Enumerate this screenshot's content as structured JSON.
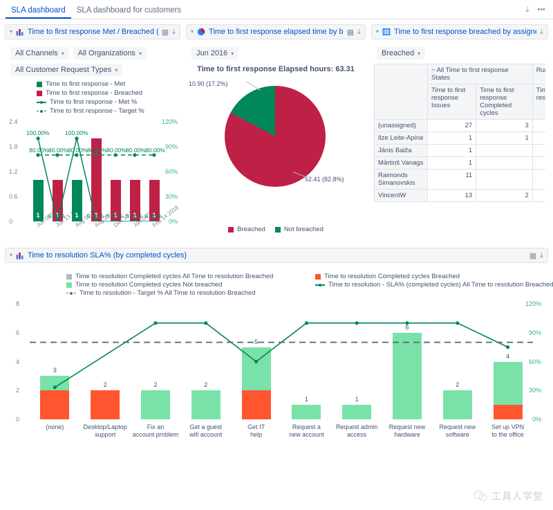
{
  "tabs": [
    {
      "label": "SLA dashboard",
      "active": true
    },
    {
      "label": "SLA dashboard for customers",
      "active": false
    }
  ],
  "header_actions": {
    "download": "⤓",
    "more": "•••"
  },
  "gadgets": {
    "first_response_met_breached": {
      "title": "Time to first response Met / Breached (by days",
      "icon": "bar-chart-icon",
      "actions": {
        "table": "▦",
        "download": "⤓"
      },
      "filters": [
        "All Channels",
        "All Organizations",
        "All Customer Request Types"
      ],
      "legend": [
        {
          "label": "Time to first response - Met",
          "color": "#00875A",
          "kind": "square"
        },
        {
          "label": "Time to first response - Breached",
          "color": "#BF2045",
          "kind": "square"
        },
        {
          "label": "Time to first response - Met %",
          "color": "#00875A",
          "kind": "line"
        },
        {
          "label": "Time to first response - Target %",
          "color": "#00875A",
          "kind": "dashed"
        }
      ]
    },
    "first_response_elapsed": {
      "title": "Time to first response elapsed time by breache",
      "icon": "pie-chart-icon",
      "actions": {
        "table": "▦",
        "download": "⤓"
      },
      "filters": [
        "Jun 2016"
      ],
      "subtitle": "Time to first response Elapsed hours: 63.31"
    },
    "breached_by_assignees": {
      "title": "Time to first response breached by assignees",
      "icon": "table-icon",
      "actions": {
        "download": "⤓"
      },
      "filters": [
        "Breached"
      ],
      "group_headers": [
        "All Time to first response States",
        "Runnin"
      ],
      "column_headers": [
        "Time to first response Issues",
        "Time to first response Completed cycles",
        "Time to first respon Issues"
      ],
      "rows": [
        {
          "name": "(unassigned)",
          "issues": "27",
          "completed": "3",
          "running": ""
        },
        {
          "name": "Ilze Leite-Apine",
          "issues": "1",
          "completed": "1",
          "running": ""
        },
        {
          "name": "Jānis Baiža",
          "issues": "1",
          "completed": "",
          "running": ""
        },
        {
          "name": "Mārtiņš Vanags",
          "issues": "1",
          "completed": "",
          "running": ""
        },
        {
          "name": "Raimonds Simanovskis",
          "issues": "11",
          "completed": "",
          "running": ""
        },
        {
          "name": "VincentW",
          "issues": "13",
          "completed": "2",
          "running": ""
        }
      ]
    },
    "resolution_sla": {
      "title": "Time to resolution SLA% (by completed cycles)",
      "icon": "bar-chart-icon",
      "actions": {
        "table": "▦",
        "download": "⤓"
      },
      "legend": [
        {
          "label": "Time to resolution Completed cycles All Time to resolution Breached",
          "color": "#B3BAC5",
          "kind": "square"
        },
        {
          "label": "Time to resolution Completed cycles Not breached",
          "color": "#79E2A8",
          "kind": "square"
        },
        {
          "label": "Time to resolution - Target % All Time to resolution Breached",
          "color": "#5E6C84",
          "kind": "dashed"
        },
        {
          "label": "Time to resolution Completed cycles Breached",
          "color": "#FF5630",
          "kind": "square"
        },
        {
          "label": "Time to resolution - SLA% (completed cycles) All Time to resolution Breached",
          "color": "#00875A",
          "kind": "line"
        }
      ]
    }
  },
  "chart_data": [
    {
      "type": "bar",
      "id": "first-response-met-breached",
      "title": "Time to first response Met / Breached (by days)",
      "categories": [
        "Jun 05 2016",
        "Jun 13 2016",
        "Aug 01 2016",
        "Aug 25 2017",
        "Dec 18 2017",
        "Jan 04 2018",
        "Feb 14 2018"
      ],
      "series": [
        {
          "name": "Time to first response - Met",
          "color": "#00875A",
          "values": [
            1,
            0,
            1,
            0,
            0,
            0,
            0
          ]
        },
        {
          "name": "Time to first response - Breached",
          "color": "#BF2045",
          "values": [
            0,
            1,
            0,
            2,
            1,
            1,
            1
          ]
        },
        {
          "name": "Time to first response - Met %",
          "color": "#00875A",
          "axis": "right",
          "values": [
            100.0,
            0.0,
            100.0,
            0.0,
            0.0,
            0.0,
            0.0
          ],
          "labels": [
            "100.00%",
            "0.00%",
            "100.00%",
            "0.00%",
            "0.00%",
            "0.00%",
            "0.00%"
          ]
        },
        {
          "name": "Time to first response - Target %",
          "color": "#00875A",
          "axis": "right",
          "dashed": true,
          "values": [
            80.0,
            80.0,
            80.0,
            80.0,
            80.0,
            80.0,
            80.0
          ],
          "labels": [
            "80.00%",
            "80.00%",
            "80.00%",
            "80.00%",
            "80.00%",
            "80.00%",
            "80.00%"
          ]
        }
      ],
      "ylabel": "",
      "ylim": [
        0,
        2.4
      ],
      "yticks": [
        "0",
        "0.6",
        "1.2",
        "1.8",
        "2.4"
      ],
      "y2lim": [
        0,
        120
      ],
      "y2ticks": [
        "0%",
        "30%",
        "60%",
        "90%",
        "120%"
      ],
      "grid": false,
      "legend_position": "top"
    },
    {
      "type": "pie",
      "id": "first-response-elapsed",
      "title": "Time to first response Elapsed hours: 63.31",
      "period": "Jun 2016",
      "labels": [
        "Breached",
        "Not breached"
      ],
      "values": [
        52.41,
        10.9
      ],
      "percentages": [
        "82.8%",
        "17.2%"
      ],
      "data_labels": [
        "52.41 (82.8%)",
        "10.90 (17.2%)"
      ],
      "colors": [
        "#BF2045",
        "#00875A"
      ],
      "legend_position": "bottom"
    },
    {
      "type": "bar",
      "id": "resolution-sla",
      "title": "Time to resolution SLA% (by completed cycles)",
      "stacked": true,
      "categories": [
        "(none)",
        "Desktop/Laptop support",
        "Fix an account problem",
        "Get a guest wifi account",
        "Get IT help",
        "Request a new account",
        "Request admin access",
        "Request new hardware",
        "Request new software",
        "Set up VPN to the office"
      ],
      "series": [
        {
          "name": "Time to resolution Completed cycles Breached",
          "color": "#FF5630",
          "values": [
            2,
            2,
            0,
            0,
            2,
            0,
            0,
            0,
            0,
            1
          ]
        },
        {
          "name": "Time to resolution Completed cycles Not breached",
          "color": "#79E2A8",
          "values": [
            1,
            0,
            2,
            2,
            3,
            1,
            1,
            6,
            2,
            3
          ]
        },
        {
          "name": "Time to resolution - SLA% (completed cycles) All Time to resolution Breached",
          "color": "#00875A",
          "axis": "right",
          "values": [
            33.3,
            null,
            100.0,
            100.0,
            60.0,
            100.0,
            100.0,
            100.0,
            100.0,
            75.0
          ]
        },
        {
          "name": "Time to resolution - Target % All Time to resolution Breached",
          "color": "#5E6C84",
          "axis": "right",
          "dashed": true,
          "values": [
            80,
            80,
            80,
            80,
            80,
            80,
            80,
            80,
            80,
            80
          ]
        }
      ],
      "totals": [
        3,
        2,
        2,
        2,
        5,
        1,
        1,
        6,
        2,
        4
      ],
      "ylim": [
        0,
        8
      ],
      "yticks": [
        "0",
        "2",
        "4",
        "6",
        "8"
      ],
      "y2lim": [
        0,
        120
      ],
      "y2ticks": [
        "0%",
        "30%",
        "60%",
        "90%",
        "120%"
      ],
      "grid": false,
      "legend_position": "top"
    }
  ],
  "watermark": {
    "text": "工具人学堂",
    "icon": "wechat-icon"
  }
}
